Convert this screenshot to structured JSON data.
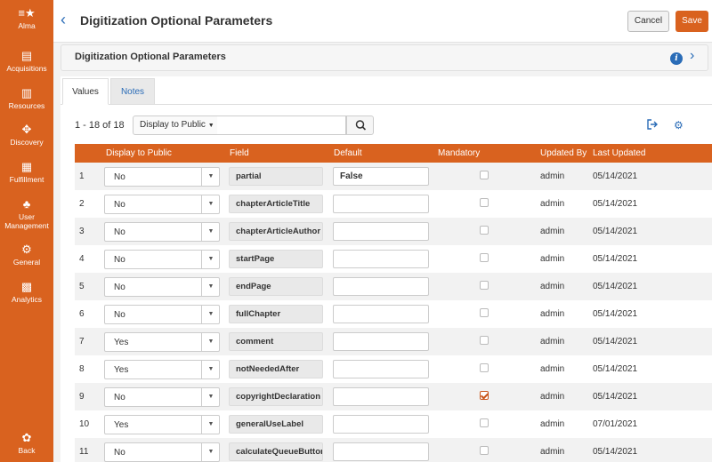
{
  "sidebar": {
    "items": [
      {
        "label": "Alma",
        "icon": "alma-menu-icon"
      },
      {
        "label": "Acquisitions",
        "icon": "acquisitions-icon"
      },
      {
        "label": "Resources",
        "icon": "resources-icon"
      },
      {
        "label": "Discovery",
        "icon": "discovery-icon"
      },
      {
        "label": "Fulfillment",
        "icon": "fulfillment-icon"
      },
      {
        "label": "User Management",
        "icon": "user-management-icon"
      },
      {
        "label": "General",
        "icon": "general-icon"
      },
      {
        "label": "Analytics",
        "icon": "analytics-icon"
      }
    ],
    "back_label": "Back"
  },
  "header": {
    "title": "Digitization Optional Parameters",
    "cancel_label": "Cancel",
    "save_label": "Save"
  },
  "section": {
    "title": "Digitization Optional Parameters"
  },
  "tabs": [
    {
      "label": "Values",
      "active": true
    },
    {
      "label": "Notes",
      "active": false
    }
  ],
  "toolbar": {
    "count": "1 - 18 of 18",
    "filter_selected": "Display to Public",
    "search_value": ""
  },
  "table": {
    "columns": [
      "Display to Public",
      "Field",
      "Default",
      "Mandatory",
      "Updated By",
      "Last Updated"
    ],
    "rows": [
      {
        "n": "1",
        "display": "No",
        "field": "partial",
        "default": "False",
        "mandatory": false,
        "by": "admin",
        "date": "05/14/2021"
      },
      {
        "n": "2",
        "display": "No",
        "field": "chapterArticleTitle",
        "default": "",
        "mandatory": false,
        "by": "admin",
        "date": "05/14/2021"
      },
      {
        "n": "3",
        "display": "No",
        "field": "chapterArticleAuthor",
        "default": "",
        "mandatory": false,
        "by": "admin",
        "date": "05/14/2021"
      },
      {
        "n": "4",
        "display": "No",
        "field": "startPage",
        "default": "",
        "mandatory": false,
        "by": "admin",
        "date": "05/14/2021"
      },
      {
        "n": "5",
        "display": "No",
        "field": "endPage",
        "default": "",
        "mandatory": false,
        "by": "admin",
        "date": "05/14/2021"
      },
      {
        "n": "6",
        "display": "No",
        "field": "fullChapter",
        "default": "",
        "mandatory": false,
        "by": "admin",
        "date": "05/14/2021"
      },
      {
        "n": "7",
        "display": "Yes",
        "field": "comment",
        "default": "",
        "mandatory": false,
        "by": "admin",
        "date": "05/14/2021"
      },
      {
        "n": "8",
        "display": "Yes",
        "field": "notNeededAfter",
        "default": "",
        "mandatory": false,
        "by": "admin",
        "date": "05/14/2021"
      },
      {
        "n": "9",
        "display": "No",
        "field": "copyrightDeclaration",
        "default": "",
        "mandatory": true,
        "by": "admin",
        "date": "05/14/2021"
      },
      {
        "n": "10",
        "display": "Yes",
        "field": "generalUseLabel",
        "default": "",
        "mandatory": false,
        "by": "admin",
        "date": "07/01/2021"
      },
      {
        "n": "11",
        "display": "No",
        "field": "calculateQueueButton",
        "default": "",
        "mandatory": false,
        "by": "admin",
        "date": "05/14/2021"
      }
    ]
  }
}
